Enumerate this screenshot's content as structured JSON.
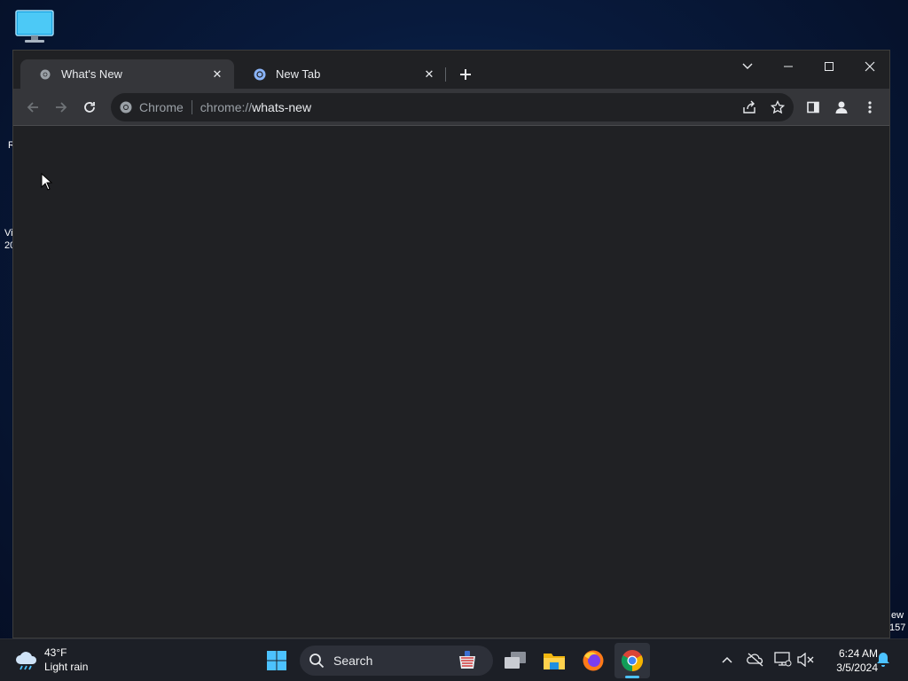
{
  "desktop": {
    "peek_texts": [
      "R",
      "Vi",
      "20",
      "ew",
      "157"
    ]
  },
  "browser": {
    "tabs": [
      {
        "title": "What's New",
        "active": true
      },
      {
        "title": "New Tab",
        "active": false
      }
    ],
    "omnibox": {
      "chip_label": "Chrome",
      "url_scheme": "chrome://",
      "url_host": "whats-new"
    }
  },
  "taskbar": {
    "weather": {
      "temperature": "43°F",
      "condition": "Light rain"
    },
    "search_label": "Search",
    "clock": {
      "time": "6:24 AM",
      "date": "3/5/2024"
    }
  },
  "colors": {
    "chrome_dark": "#202124",
    "chrome_toolbar": "#35363a",
    "taskbar": "#1c1f26",
    "accent_blue": "#4cc2ff"
  }
}
